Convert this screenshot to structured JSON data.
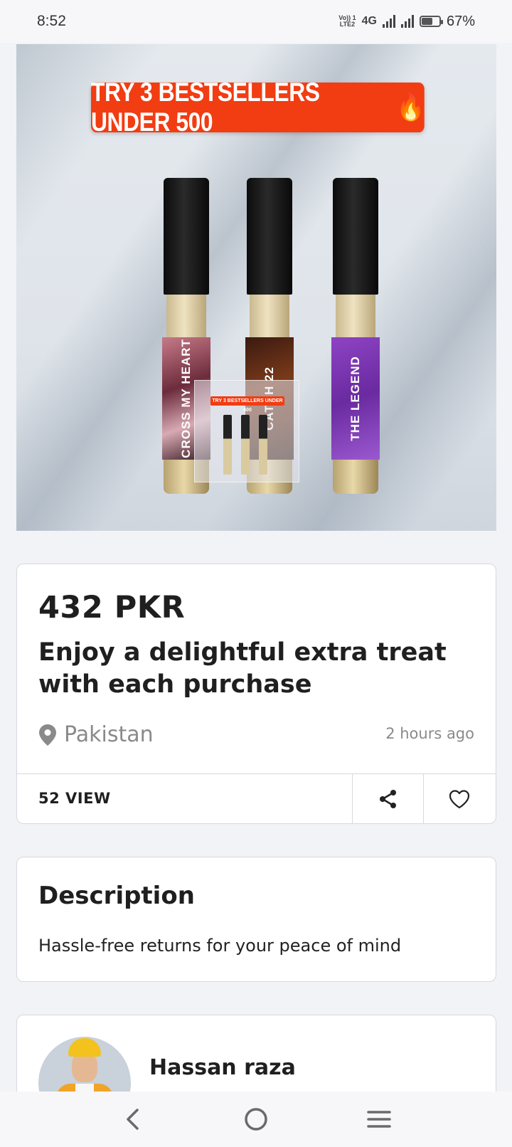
{
  "status_bar": {
    "time": "8:52",
    "volte_line1": "Vo)) 1",
    "volte_line2": "LTE2",
    "network": "4G",
    "battery": "67%",
    "battery_level": 0.67
  },
  "product_image": {
    "banner_text": "TRY 3 BESTSELLERS UNDER 500",
    "banner_emoji": "🔥",
    "vials": [
      "CROSS MY HEART",
      "CATCH 22",
      "THE LEGEND"
    ],
    "thumbnail_banner": "TRY 3 BESTSELLERS UNDER 500"
  },
  "listing": {
    "price": "432 PKR",
    "title": "Enjoy a delightful extra treat with each purchase",
    "location": "Pakistan",
    "posted": "2 hours ago",
    "views": "52 VIEW"
  },
  "description": {
    "heading": "Description",
    "text": "Hassle-free returns for your peace of mind"
  },
  "seller": {
    "name": "Hassan raza"
  },
  "icons": {
    "location": "map-pin-icon",
    "share": "share-icon",
    "like": "heart-icon",
    "back": "back-chevron-icon",
    "home": "home-circle-icon",
    "menu": "menu-icon"
  },
  "colors": {
    "banner": "#f23c12",
    "background": "#f2f3f7",
    "muted_text": "#8a8a8a"
  }
}
